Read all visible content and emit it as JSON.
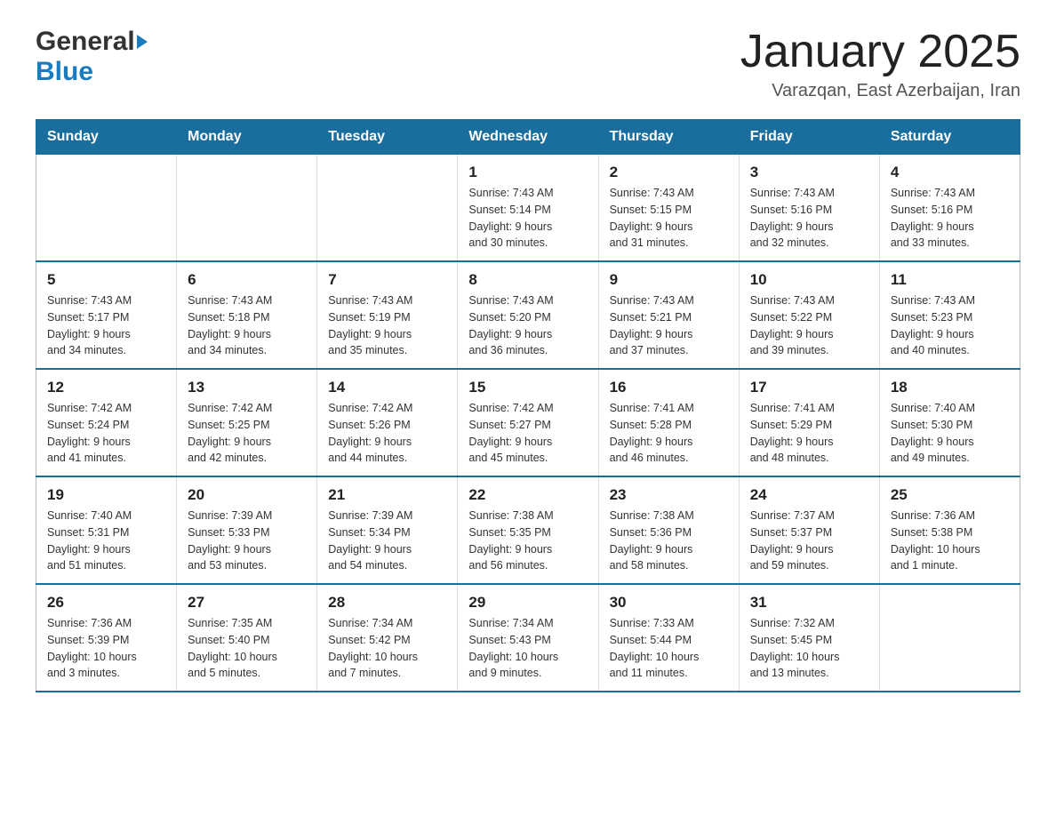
{
  "header": {
    "title": "January 2025",
    "location": "Varazqan, East Azerbaijan, Iran",
    "logo_general": "General",
    "logo_blue": "Blue"
  },
  "weekdays": [
    "Sunday",
    "Monday",
    "Tuesday",
    "Wednesday",
    "Thursday",
    "Friday",
    "Saturday"
  ],
  "weeks": [
    [
      {
        "day": "",
        "info": ""
      },
      {
        "day": "",
        "info": ""
      },
      {
        "day": "",
        "info": ""
      },
      {
        "day": "1",
        "info": "Sunrise: 7:43 AM\nSunset: 5:14 PM\nDaylight: 9 hours\nand 30 minutes."
      },
      {
        "day": "2",
        "info": "Sunrise: 7:43 AM\nSunset: 5:15 PM\nDaylight: 9 hours\nand 31 minutes."
      },
      {
        "day": "3",
        "info": "Sunrise: 7:43 AM\nSunset: 5:16 PM\nDaylight: 9 hours\nand 32 minutes."
      },
      {
        "day": "4",
        "info": "Sunrise: 7:43 AM\nSunset: 5:16 PM\nDaylight: 9 hours\nand 33 minutes."
      }
    ],
    [
      {
        "day": "5",
        "info": "Sunrise: 7:43 AM\nSunset: 5:17 PM\nDaylight: 9 hours\nand 34 minutes."
      },
      {
        "day": "6",
        "info": "Sunrise: 7:43 AM\nSunset: 5:18 PM\nDaylight: 9 hours\nand 34 minutes."
      },
      {
        "day": "7",
        "info": "Sunrise: 7:43 AM\nSunset: 5:19 PM\nDaylight: 9 hours\nand 35 minutes."
      },
      {
        "day": "8",
        "info": "Sunrise: 7:43 AM\nSunset: 5:20 PM\nDaylight: 9 hours\nand 36 minutes."
      },
      {
        "day": "9",
        "info": "Sunrise: 7:43 AM\nSunset: 5:21 PM\nDaylight: 9 hours\nand 37 minutes."
      },
      {
        "day": "10",
        "info": "Sunrise: 7:43 AM\nSunset: 5:22 PM\nDaylight: 9 hours\nand 39 minutes."
      },
      {
        "day": "11",
        "info": "Sunrise: 7:43 AM\nSunset: 5:23 PM\nDaylight: 9 hours\nand 40 minutes."
      }
    ],
    [
      {
        "day": "12",
        "info": "Sunrise: 7:42 AM\nSunset: 5:24 PM\nDaylight: 9 hours\nand 41 minutes."
      },
      {
        "day": "13",
        "info": "Sunrise: 7:42 AM\nSunset: 5:25 PM\nDaylight: 9 hours\nand 42 minutes."
      },
      {
        "day": "14",
        "info": "Sunrise: 7:42 AM\nSunset: 5:26 PM\nDaylight: 9 hours\nand 44 minutes."
      },
      {
        "day": "15",
        "info": "Sunrise: 7:42 AM\nSunset: 5:27 PM\nDaylight: 9 hours\nand 45 minutes."
      },
      {
        "day": "16",
        "info": "Sunrise: 7:41 AM\nSunset: 5:28 PM\nDaylight: 9 hours\nand 46 minutes."
      },
      {
        "day": "17",
        "info": "Sunrise: 7:41 AM\nSunset: 5:29 PM\nDaylight: 9 hours\nand 48 minutes."
      },
      {
        "day": "18",
        "info": "Sunrise: 7:40 AM\nSunset: 5:30 PM\nDaylight: 9 hours\nand 49 minutes."
      }
    ],
    [
      {
        "day": "19",
        "info": "Sunrise: 7:40 AM\nSunset: 5:31 PM\nDaylight: 9 hours\nand 51 minutes."
      },
      {
        "day": "20",
        "info": "Sunrise: 7:39 AM\nSunset: 5:33 PM\nDaylight: 9 hours\nand 53 minutes."
      },
      {
        "day": "21",
        "info": "Sunrise: 7:39 AM\nSunset: 5:34 PM\nDaylight: 9 hours\nand 54 minutes."
      },
      {
        "day": "22",
        "info": "Sunrise: 7:38 AM\nSunset: 5:35 PM\nDaylight: 9 hours\nand 56 minutes."
      },
      {
        "day": "23",
        "info": "Sunrise: 7:38 AM\nSunset: 5:36 PM\nDaylight: 9 hours\nand 58 minutes."
      },
      {
        "day": "24",
        "info": "Sunrise: 7:37 AM\nSunset: 5:37 PM\nDaylight: 9 hours\nand 59 minutes."
      },
      {
        "day": "25",
        "info": "Sunrise: 7:36 AM\nSunset: 5:38 PM\nDaylight: 10 hours\nand 1 minute."
      }
    ],
    [
      {
        "day": "26",
        "info": "Sunrise: 7:36 AM\nSunset: 5:39 PM\nDaylight: 10 hours\nand 3 minutes."
      },
      {
        "day": "27",
        "info": "Sunrise: 7:35 AM\nSunset: 5:40 PM\nDaylight: 10 hours\nand 5 minutes."
      },
      {
        "day": "28",
        "info": "Sunrise: 7:34 AM\nSunset: 5:42 PM\nDaylight: 10 hours\nand 7 minutes."
      },
      {
        "day": "29",
        "info": "Sunrise: 7:34 AM\nSunset: 5:43 PM\nDaylight: 10 hours\nand 9 minutes."
      },
      {
        "day": "30",
        "info": "Sunrise: 7:33 AM\nSunset: 5:44 PM\nDaylight: 10 hours\nand 11 minutes."
      },
      {
        "day": "31",
        "info": "Sunrise: 7:32 AM\nSunset: 5:45 PM\nDaylight: 10 hours\nand 13 minutes."
      },
      {
        "day": "",
        "info": ""
      }
    ]
  ]
}
